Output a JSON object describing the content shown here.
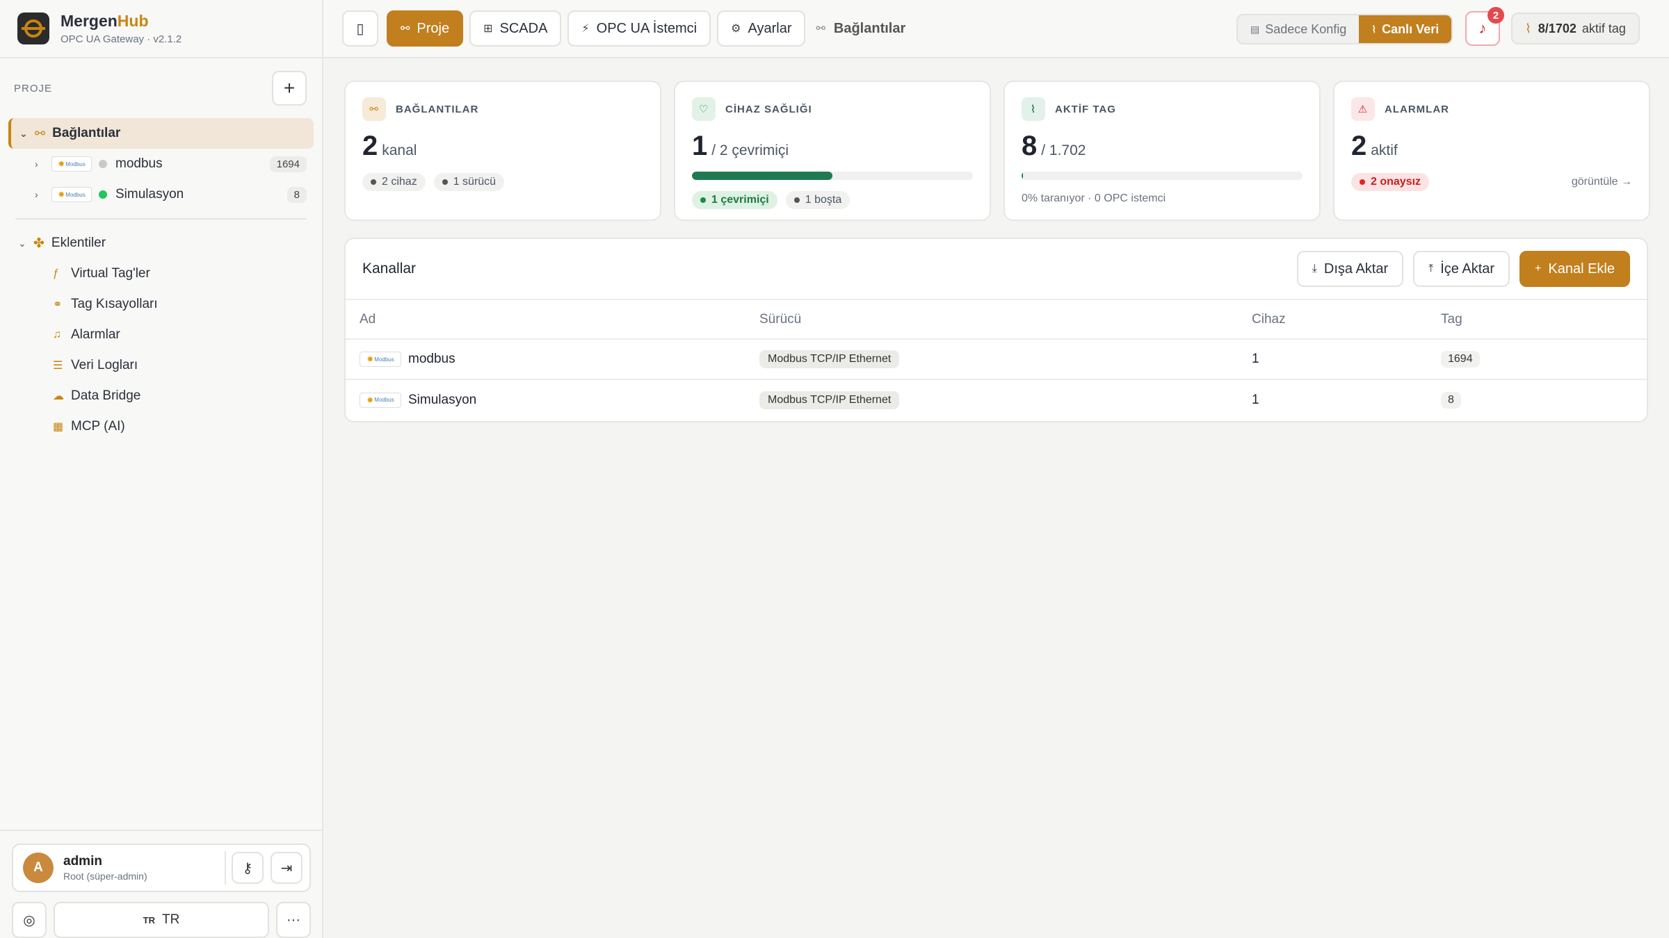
{
  "app": {
    "name_main": "Mergen",
    "name_accent": "Hub",
    "subtitle": "OPC UA Gateway · v2.1.2"
  },
  "sidebar": {
    "section_label": "PROJE",
    "add_label": "+",
    "root": {
      "label": "Bağlantılar"
    },
    "channels": [
      {
        "name": "modbus",
        "status": "offline",
        "count": "1694"
      },
      {
        "name": "Simulasyon",
        "status": "online",
        "count": "8"
      }
    ],
    "plugins_label": "Eklentiler",
    "plugins": [
      {
        "label": "Virtual Tag'ler",
        "icon": "function-icon"
      },
      {
        "label": "Tag Kısayolları",
        "icon": "link-icon"
      },
      {
        "label": "Alarmlar",
        "icon": "alarm-icon"
      },
      {
        "label": "Veri Logları",
        "icon": "database-icon"
      },
      {
        "label": "Data Bridge",
        "icon": "cloud-icon"
      },
      {
        "label": "MCP (AI)",
        "icon": "ai-icon"
      }
    ],
    "user": {
      "initial": "A",
      "name": "admin",
      "role": "Root (süper-admin)"
    },
    "language": {
      "flag": "TR",
      "label": "TR"
    }
  },
  "topbar": {
    "tabs": [
      {
        "label": "Proje",
        "active": true
      },
      {
        "label": "SCADA",
        "active": false
      },
      {
        "label": "OPC UA İstemci",
        "active": false
      },
      {
        "label": "Ayarlar",
        "active": false
      }
    ],
    "breadcrumb": "Bağlantılar",
    "mode_config": "Sadece Konfig",
    "mode_live": "Canlı Veri",
    "notifications": "2",
    "tag_status_value": "8/1702",
    "tag_status_label": "aktif tag"
  },
  "cards": {
    "connections": {
      "title": "BAĞLANTILAR",
      "value": "2",
      "unit": "kanal",
      "pill1": "2 cihaz",
      "pill2": "1 sürücü"
    },
    "health": {
      "title": "CİHAZ SAĞLIĞI",
      "value": "1",
      "unit": "/ 2 çevrimiçi",
      "online_fraction": 0.5,
      "pill1": "1 çevrimiçi",
      "pill2": "1 boşta"
    },
    "active_tag": {
      "title": "AKTİF TAG",
      "value": "8",
      "unit": "/ 1.702",
      "scan_fraction": 0.005,
      "note": "0% taranıyor · 0 OPC istemci"
    },
    "alarms": {
      "title": "ALARMLAR",
      "value": "2",
      "unit": "aktif",
      "pill1": "2 onaysız",
      "link": "görüntüle →"
    }
  },
  "channels_panel": {
    "title": "Kanallar",
    "export_label": "Dışa Aktar",
    "import_label": "İçe Aktar",
    "add_label": "Kanal Ekle",
    "columns": [
      "Ad",
      "Sürücü",
      "Cihaz",
      "Tag"
    ],
    "rows": [
      {
        "name": "modbus",
        "driver": "Modbus TCP/IP Ethernet",
        "devices": "1",
        "tags": "1694"
      },
      {
        "name": "Simulasyon",
        "driver": "Modbus TCP/IP Ethernet",
        "devices": "1",
        "tags": "8"
      }
    ]
  },
  "logo_text": "Modbus",
  "colors": {
    "accent": "#c17f1e",
    "online": "#22c55e",
    "alarm": "#dc2626",
    "health_bar": "#1f7a52"
  }
}
